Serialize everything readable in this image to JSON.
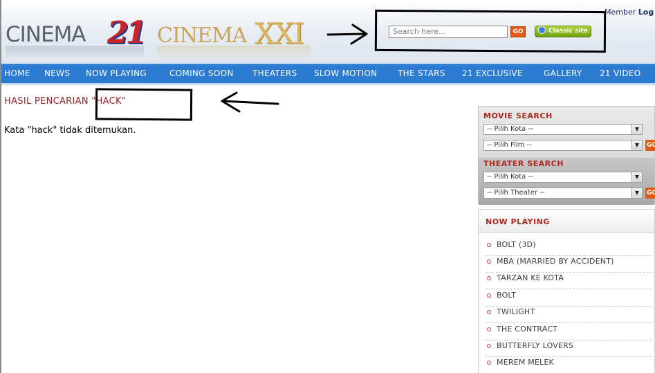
{
  "header": {
    "logo_cinema21_word": "CINEMA",
    "logo_cinema21_num": "21",
    "logo_cinemaxxi_word": "CINEMA",
    "logo_cinemaxxi_num": "XXI",
    "member_prefix": "Member",
    "member_login": "Log",
    "search_placeholder": "Search here...",
    "go_label": "GO",
    "classic_label": "Classic site"
  },
  "nav": {
    "items": [
      "HOME",
      "NEWS",
      "NOW PLAYING",
      "COMING SOON",
      "THEATERS",
      "SLOW MOTION",
      "THE STARS",
      "21 EXCLUSIVE",
      "GALLERY",
      "21 VIDEO"
    ]
  },
  "content": {
    "result_title": "HASIL PENCARIAN \"HACK\"",
    "result_message": "Kata \"hack\" tidak ditemukan."
  },
  "sidebar": {
    "movie_search_label": "MOVIE SEARCH",
    "movie_city": "-- Pilih Kota --",
    "movie_film": "-- Pilih Film --",
    "theater_search_label": "THEATER SEARCH",
    "theater_city": "-- Pilih Kota --",
    "theater_theater": "-- Pilih Theater --",
    "go_label": "GO",
    "now_playing_title": "NOW PLAYING",
    "now_playing": [
      "BOLT (3D)",
      "MBA (MARRIED BY ACCIDENT)",
      "TARZAN KE KOTA",
      "BOLT",
      "TWILIGHT",
      "THE CONTRACT",
      "BUTTERFLY LOVERS",
      "MEREM MELEK"
    ]
  },
  "colors": {
    "nav_bg": "#2c7bd3",
    "accent_red": "#b1261e",
    "go_orange": "#e25b14",
    "classic_green": "#8bbb22"
  }
}
